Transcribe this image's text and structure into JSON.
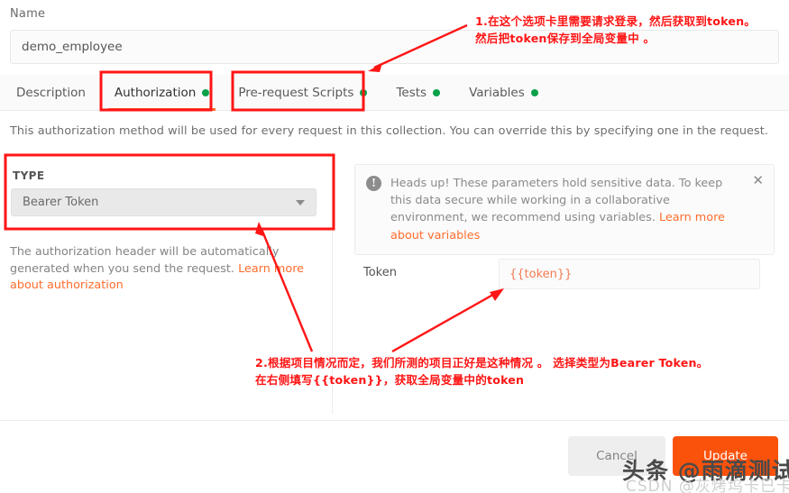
{
  "form": {
    "name_label": "Name",
    "name_value": "demo_employee"
  },
  "tabs": [
    {
      "label": "Description",
      "has_dot": false,
      "active": false
    },
    {
      "label": "Authorization",
      "has_dot": true,
      "active": true
    },
    {
      "label": "Pre-request Scripts",
      "has_dot": true,
      "active": false
    },
    {
      "label": "Tests",
      "has_dot": true,
      "active": false
    },
    {
      "label": "Variables",
      "has_dot": true,
      "active": false
    }
  ],
  "description": "This authorization method will be used for every request in this collection. You can override this by specifying one in the request.",
  "auth": {
    "type_label": "TYPE",
    "type_value": "Bearer Token",
    "caret_icon": "chevron-down-icon",
    "help_text": "The authorization header will be automatically generated when you send the request. ",
    "help_link": "Learn more about authorization"
  },
  "notice": {
    "icon": "exclamation-circle-icon",
    "text": "Heads up! These parameters hold sensitive data. To keep this data secure while working in a collaborative environment, we recommend using variables. ",
    "link": "Learn more about variables",
    "close_icon": "✕"
  },
  "token": {
    "label": "Token",
    "value": "{{token}}"
  },
  "footer": {
    "cancel_label": "Cancel",
    "update_label": "Update"
  },
  "annotations": {
    "one_line1": "1.在这个选项卡里需要请求登录，然后获取到token。",
    "one_line2": "然后把token保存到全局变量中 。",
    "two_line1": "2.根据项目情况而定，我们所测的项目正好是这种情况 。 选择类型为Bearer Token。",
    "two_line2": "在右侧填写{{token}}，获取全局变量中的token"
  },
  "watermarks": {
    "main": "头条 @雨滴测试",
    "sub": "CSDN @灰烤坞卡已卡"
  },
  "colors": {
    "accent_orange": "#fb520b",
    "tab_underline": "#ff6c2c",
    "annotation_red": "#ff1515",
    "status_dot_green": "#0aa14a",
    "link_orange": "#ff6c2c"
  }
}
